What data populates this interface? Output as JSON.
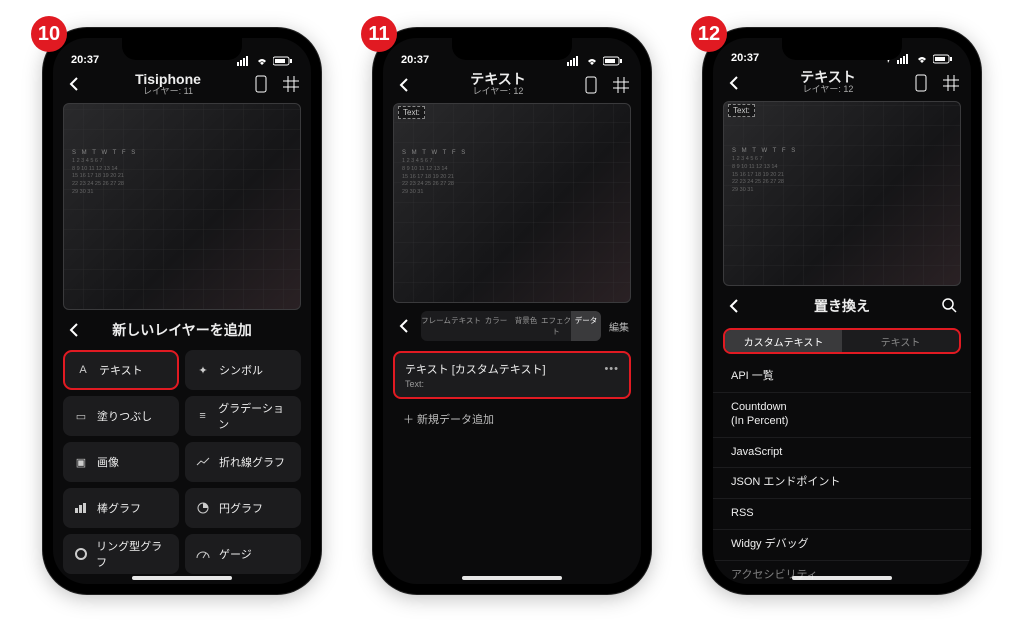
{
  "step_labels": [
    "10",
    "11",
    "12"
  ],
  "status": {
    "time": "20:37"
  },
  "screen10": {
    "title": "Tisiphone",
    "subtitle": "レイヤー: 11",
    "panel_title": "新しいレイヤーを追加",
    "tiles": [
      {
        "icon": "text",
        "label": "テキスト"
      },
      {
        "icon": "symbol",
        "label": "シンボル"
      },
      {
        "icon": "fill",
        "label": "塗りつぶし"
      },
      {
        "icon": "gradient",
        "label": "グラデーション"
      },
      {
        "icon": "image",
        "label": "画像"
      },
      {
        "icon": "linechart",
        "label": "折れ線グラフ"
      },
      {
        "icon": "barchart",
        "label": "棒グラフ"
      },
      {
        "icon": "piechart",
        "label": "円グラフ"
      },
      {
        "icon": "ringchart",
        "label": "リング型グラフ"
      },
      {
        "icon": "gauge",
        "label": "ゲージ"
      }
    ],
    "canvas": {
      "dow": "S  M  T  W  T  F  S"
    }
  },
  "screen11": {
    "title": "テキスト",
    "subtitle": "レイヤー: 12",
    "canvas_text_label": "Text:",
    "seg_tabs": [
      "フレーム",
      "テキスト",
      "カラー",
      "背景色",
      "エフェクト",
      "データ"
    ],
    "seg_active_index": 5,
    "edit_label": "編集",
    "data_item_title": "テキスト [カスタムテキスト]",
    "data_item_sub": "Text:",
    "add_new": "＋ 新規データ追加"
  },
  "screen12": {
    "title": "テキスト",
    "subtitle": "レイヤー: 12",
    "canvas_text_label": "Text:",
    "panel_title": "置き換え",
    "seg2": [
      "カスタムテキスト",
      "テキスト"
    ],
    "seg2_active_index": 0,
    "list": [
      "API 一覧",
      "Countdown\n(In Percent)",
      "JavaScript",
      "JSON エンドポイント",
      "RSS",
      "Widgy デバッグ",
      "アクセシビリティ"
    ]
  }
}
